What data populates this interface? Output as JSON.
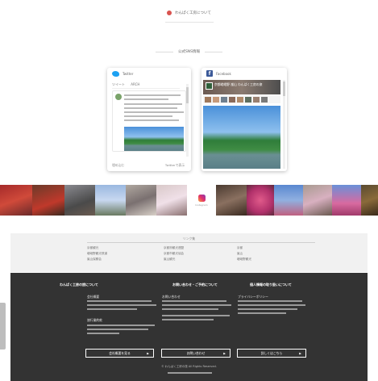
{
  "top_link": {
    "label": "わんぱく工房について"
  },
  "social": {
    "heading": "公式SNS情報",
    "twitter": {
      "name": "Twitter",
      "feed_title": "ツイート",
      "handle": "ARCH",
      "footer_left": "埋め込む",
      "footer_right": "Twitterで表示"
    },
    "facebook": {
      "name": "Facebook",
      "page_title": "京都嵯峨野 嵐山 わんぱく工房の旅"
    }
  },
  "instagram": {
    "label": "Instagram"
  },
  "links": {
    "title": "リンク集",
    "col1": [
      "京都観光",
      "嵯峨野観光鉄道",
      "嵐山保勝会"
    ],
    "col2": [
      "京都府観光連盟",
      "京都市観光協会",
      "嵐山観光"
    ],
    "col3": [
      "京都",
      "嵐山",
      "嵯峨野観光"
    ]
  },
  "footer": {
    "columns": [
      {
        "heading": "わんぱく工房の旅について",
        "sub1": "会社概要",
        "sub2": "旅行業約款",
        "button": "会社概要を見る"
      },
      {
        "heading": "お問い合わせ・ご予約について",
        "sub1": "お問い合わせ",
        "sub2": "",
        "button": "お問い合わせ"
      },
      {
        "heading": "個人情報の取り扱いについて",
        "sub1": "プライバシーポリシー",
        "sub2": "",
        "button": "詳しくはこちら"
      }
    ],
    "copyright": "© わんぱく工房の旅 All Rights Reserved."
  },
  "colors": {
    "twitter": "#1da1f2",
    "facebook": "#3b5998",
    "footer_bg": "#333333",
    "link_band_bg": "#f1f1f1"
  },
  "icons": [
    "map-pin-icon",
    "twitter-bird-icon",
    "facebook-f-icon",
    "instagram-icon",
    "arrow-right-icon"
  ]
}
